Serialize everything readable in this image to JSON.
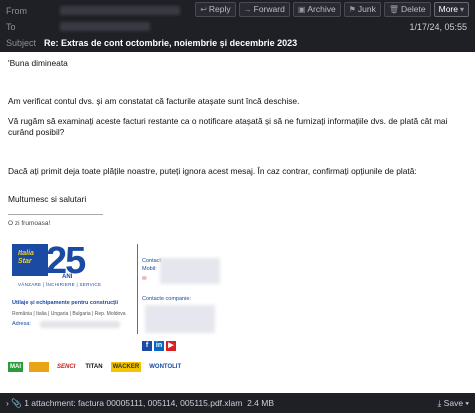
{
  "header": {
    "from_label": "From",
    "to_label": "To",
    "subject_label": "Subject",
    "subject": "Re: Extras de cont octombrie, noiembrie și decembrie 2023",
    "date": "1/17/24, 05:55",
    "toolbar": {
      "reply": "Reply",
      "forward": "Forward",
      "archive": "Archive",
      "junk": "Junk",
      "delete": "Delete",
      "more": "More"
    }
  },
  "body": {
    "greeting": "'Buna dimineata",
    "p1": "Am verificat contul dvs. și am constatat că facturile atașate sunt încă deschise.",
    "p2": "Vă rugăm să examinați aceste facturi restante ca o notificare atașată și să ne furnizați informațiile dvs. de plată cât mai curând posibil?",
    "p3": "Dacă ați primit deja toate plățile noastre, puteți ignora acest mesaj. În caz contrar, confirmați opțiunile de plată:",
    "closing": "Multumesc si salutari"
  },
  "signature": {
    "small_line": "O zi frumoasa!",
    "logo_text": "Italia Star",
    "logo_number": "25",
    "logo_ani": "ANI",
    "logo_tagline": "VÂNZARE | ÎNCHIRIERE | SERVICE",
    "utilaje": "Utilaje și echipamente pentru construcții",
    "countries": "România | Italia | Ungaria | Bulgaria | Rep. Moldova",
    "adresa": "Adresa:",
    "contact_label": "Contact:",
    "mobil_label": "Mobil:",
    "email_label": "✉",
    "contacte": "Contacte companie:",
    "social_fb": "f",
    "social_in": "in",
    "social_yt": "▶"
  },
  "brands": [
    "MAI",
    "—",
    "SENCI",
    "TITAN",
    "WACKER",
    "WONTOLIT"
  ],
  "attachment": {
    "text": "1 attachment: factura 00005111, 005114, 005115.pdf.xlam",
    "size": "2.4 MB",
    "save": "Save"
  },
  "colors": {
    "header_bg": "#1f1f26",
    "brand_blue": "#1b4aa3"
  }
}
